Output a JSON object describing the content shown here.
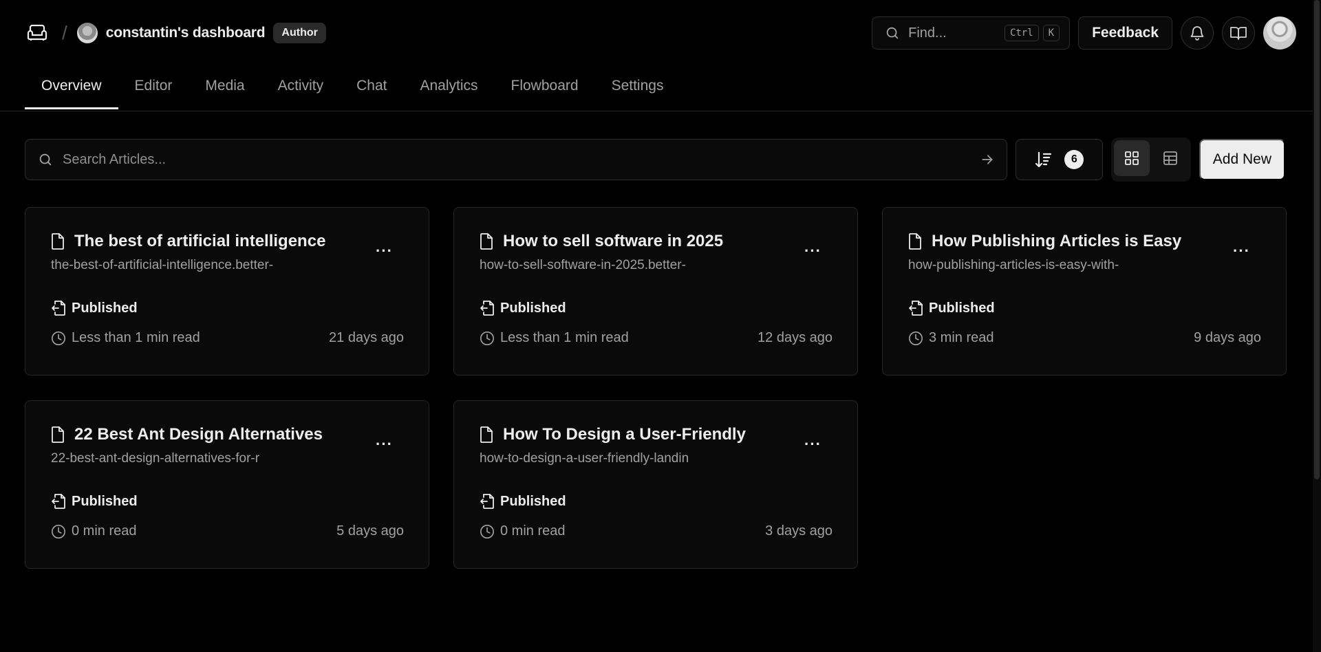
{
  "header": {
    "logo_icon": "sofa-icon",
    "separator": "/",
    "team_name": "constantin's dashboard",
    "role_badge": "Author",
    "find_placeholder": "Find...",
    "shortcut_keys": [
      "Ctrl",
      "K"
    ],
    "feedback_label": "Feedback",
    "icons": [
      "bell-icon",
      "book-open-icon"
    ]
  },
  "tabs": [
    {
      "label": "Overview",
      "active": true
    },
    {
      "label": "Editor",
      "active": false
    },
    {
      "label": "Media",
      "active": false
    },
    {
      "label": "Activity",
      "active": false
    },
    {
      "label": "Chat",
      "active": false
    },
    {
      "label": "Analytics",
      "active": false
    },
    {
      "label": "Flowboard",
      "active": false
    },
    {
      "label": "Settings",
      "active": false
    }
  ],
  "toolbar": {
    "search_placeholder": "Search Articles...",
    "sort_count": "6",
    "view_mode": "grid",
    "add_label": "Add New"
  },
  "articles": [
    {
      "title": "The best of artificial intelligence",
      "slug": "the-best-of-artificial-intelligence.better-",
      "status": "Published",
      "read_time": "Less than 1 min read",
      "age": "21 days ago"
    },
    {
      "title": "How to sell software in 2025",
      "slug": "how-to-sell-software-in-2025.better-",
      "status": "Published",
      "read_time": "Less than 1 min read",
      "age": "12 days ago"
    },
    {
      "title": "How Publishing Articles is Easy",
      "slug": "how-publishing-articles-is-easy-with-",
      "status": "Published",
      "read_time": "3 min read",
      "age": "9 days ago"
    },
    {
      "title": "22 Best Ant Design Alternatives",
      "slug": "22-best-ant-design-alternatives-for-r",
      "status": "Published",
      "read_time": "0 min read",
      "age": "5 days ago"
    },
    {
      "title": "How To Design a User-Friendly",
      "slug": "how-to-design-a-user-friendly-landin",
      "status": "Published",
      "read_time": "0 min read",
      "age": "3 days ago"
    }
  ],
  "colors": {
    "background": "#000000",
    "surface": "#0a0a0a",
    "border": "#262626",
    "text": "#ededed",
    "muted": "#a1a1a1"
  }
}
